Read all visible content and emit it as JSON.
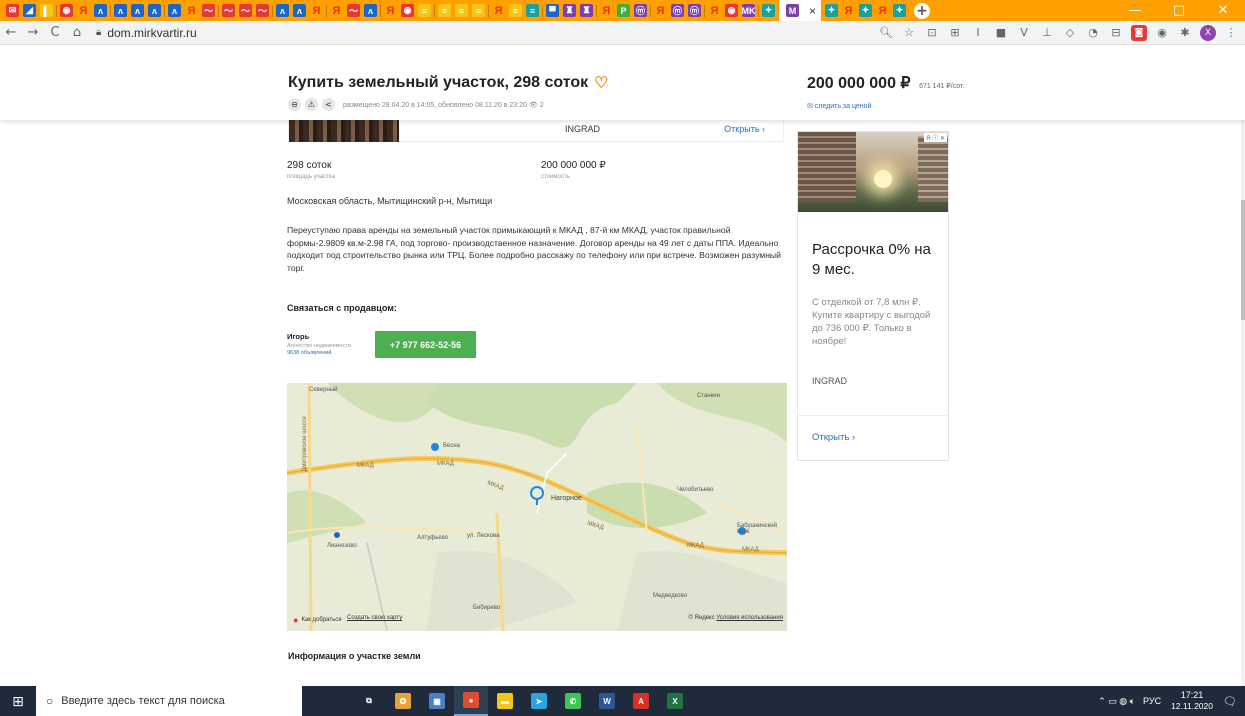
{
  "browser": {
    "tab_favicons": [
      {
        "kind": "red",
        "glyph": "✉"
      },
      {
        "kind": "blue",
        "glyph": "◢"
      },
      {
        "kind": "yellow",
        "glyph": "▌"
      },
      {
        "kind": "red",
        "glyph": "◉"
      },
      {
        "kind": "ya",
        "glyph": "Я"
      },
      {
        "kind": "blue",
        "glyph": "ʌ"
      },
      {
        "kind": "blue",
        "glyph": "ʌ"
      },
      {
        "kind": "blue",
        "glyph": "ʌ"
      },
      {
        "kind": "blue",
        "glyph": "ʌ"
      },
      {
        "kind": "blue",
        "glyph": "ʌ"
      },
      {
        "kind": "ya",
        "glyph": "Я"
      },
      {
        "kind": "red",
        "glyph": "～"
      },
      {
        "kind": "red",
        "glyph": "～"
      },
      {
        "kind": "red",
        "glyph": "～"
      },
      {
        "kind": "red",
        "glyph": "～"
      },
      {
        "kind": "blue",
        "glyph": "ʌ"
      },
      {
        "kind": "blue",
        "glyph": "ʌ"
      },
      {
        "kind": "ya",
        "glyph": "Я"
      },
      {
        "kind": "ya",
        "glyph": "Я"
      },
      {
        "kind": "red",
        "glyph": "～"
      },
      {
        "kind": "blue",
        "glyph": "ʌ"
      },
      {
        "kind": "ya",
        "glyph": "Я"
      },
      {
        "kind": "red",
        "glyph": "◉"
      },
      {
        "kind": "yellow",
        "glyph": "≡"
      },
      {
        "kind": "yellow",
        "glyph": "≡"
      },
      {
        "kind": "yellow",
        "glyph": "≡"
      },
      {
        "kind": "yellow",
        "glyph": "≡"
      },
      {
        "kind": "ya",
        "glyph": "Я"
      },
      {
        "kind": "yellow",
        "glyph": "≡"
      },
      {
        "kind": "teal",
        "glyph": "≡"
      },
      {
        "kind": "blue",
        "glyph": "▀"
      },
      {
        "kind": "purple",
        "glyph": "♜"
      },
      {
        "kind": "purple",
        "glyph": "♜"
      },
      {
        "kind": "ya",
        "glyph": "Я"
      },
      {
        "kind": "green",
        "glyph": "P"
      },
      {
        "kind": "purple",
        "glyph": "ⓜ"
      },
      {
        "kind": "ya",
        "glyph": "Я"
      },
      {
        "kind": "purple",
        "glyph": "ⓜ"
      },
      {
        "kind": "purple",
        "glyph": "ⓜ"
      },
      {
        "kind": "ya",
        "glyph": "Я"
      },
      {
        "kind": "red",
        "glyph": "◉"
      },
      {
        "kind": "purple",
        "glyph": "MK"
      },
      {
        "kind": "teal",
        "glyph": "✦"
      }
    ],
    "active_tab_close": "×",
    "tab_favicons_after": [
      {
        "kind": "teal",
        "glyph": "✦"
      },
      {
        "kind": "ya",
        "glyph": "Я"
      },
      {
        "kind": "teal",
        "glyph": "✦"
      },
      {
        "kind": "ya",
        "glyph": "Я"
      },
      {
        "kind": "teal",
        "glyph": "✦"
      }
    ],
    "new_tab": "+",
    "window_controls": {
      "minimize": "—",
      "maximize": "□",
      "close": "✕"
    },
    "nav": {
      "back": "←",
      "forward": "→",
      "reload": "C",
      "home": "⌂"
    },
    "url": "dom.mirkvartir.ru",
    "extensions": [
      {
        "glyph": "🔍︎",
        "kind": "plain"
      },
      {
        "glyph": "☆",
        "kind": "plain"
      },
      {
        "glyph": "⊡",
        "kind": "plain"
      },
      {
        "glyph": "⊞",
        "kind": "plain"
      },
      {
        "glyph": "I",
        "kind": "plain"
      },
      {
        "glyph": "■",
        "kind": "plain"
      },
      {
        "glyph": "V",
        "kind": "plain"
      },
      {
        "glyph": "⊥",
        "kind": "plain"
      },
      {
        "glyph": "◇",
        "kind": "plain"
      },
      {
        "glyph": "◔",
        "kind": "plain"
      },
      {
        "glyph": "⊟",
        "kind": "plain"
      },
      {
        "glyph": "◙",
        "kind": "sq-red"
      },
      {
        "glyph": "◉",
        "kind": "plain"
      },
      {
        "glyph": "✱",
        "kind": "plain"
      },
      {
        "glyph": "X",
        "kind": "profile"
      },
      {
        "glyph": "⋮",
        "kind": "plain"
      }
    ]
  },
  "header": {
    "title": "Купить земельный участок, 298 соток",
    "heart_icon": "♡",
    "print_icon": "⊖",
    "warn_icon": "⚠",
    "share_icon": "<",
    "posted": "размещено 28.04.20 в 14:05, обновлено 08.11.20 в 23:20",
    "views_icon": "👁︎",
    "views": "2",
    "price": "200 000 000 ₽",
    "price_per": "671 141 ₽/сот.",
    "watch_price": "✉ следить за ценой"
  },
  "agency_strip": {
    "name": "INGRAD",
    "open": "Открыть ›"
  },
  "stats": [
    {
      "value": "298 соток",
      "label": "площадь участка"
    },
    {
      "value": "200 000 000 ₽",
      "label": "стоимость"
    }
  ],
  "location": "Московская область, Мытищинский р-н, Мытищи",
  "description": "Переуступаю права аренды на земельный участок примыкающий к МКАД , 87-й км МКАД, участок правильной формы-2.9809 кв.м-2.98 ГА, под торгово- производственное назначение. Договор аренды на 49 лет с даты ППА. Идеально подходит под строительство рынка или ТРЦ. Более подробно расскажу по телефону или при встрече. Возможен разумный торг.",
  "contact": {
    "title": "Связаться с продавцом:",
    "seller_name": "Игорь",
    "seller_role": "Агентство недвижимости",
    "seller_ads": "9638 объявлений",
    "phone": "+7 977 662-52-56"
  },
  "map": {
    "labels": [
      {
        "text": "Северный"
      },
      {
        "text": "Дмитровское шоссе"
      },
      {
        "text": "Весна"
      },
      {
        "text": "МКАД"
      },
      {
        "text": "МКАД"
      },
      {
        "text": "МКАД"
      },
      {
        "text": "Нагорное"
      },
      {
        "text": "Челобитьево"
      },
      {
        "text": "МКАД"
      },
      {
        "text": "МКАД"
      },
      {
        "text": "Лианозово"
      },
      {
        "text": "Алтуфьево"
      },
      {
        "text": "ул. Лескова"
      },
      {
        "text": "Бибирево"
      },
      {
        "text": "Медведково"
      },
      {
        "text": "Бабушкинский парк"
      },
      {
        "text": "Станкин"
      },
      {
        "text": "МКАД"
      }
    ],
    "route": "Как добраться",
    "create_map": "Создать свою карту",
    "credit_brand": "© Яндекс",
    "credit_terms": "Условия использования"
  },
  "info_title": "Информация о участке земли",
  "ad": {
    "badge": "Я ⓘ ✕",
    "headline": "Рассрочка 0% на 9 мес.",
    "text": "С отделкой от 7,8 млн ₽. Купите квартиру с выгодой до 736 000 ₽. Только в ноябре!",
    "brand": "INGRAD",
    "open": "Открыть ›"
  },
  "taskbar": {
    "start_icon": "⊞",
    "search_icon": "○",
    "search_placeholder": "Введите здесь текст для поиска",
    "apps": [
      {
        "name": "task-view",
        "glyph": "⧉",
        "color": "#1f2b3a"
      },
      {
        "name": "people",
        "glyph": "✪",
        "color": "#e8a23a"
      },
      {
        "name": "calculator",
        "glyph": "▦",
        "color": "#4a7fc1"
      },
      {
        "name": "chrome",
        "glyph": "●",
        "color": "#e04c2f",
        "active": true
      },
      {
        "name": "explorer",
        "glyph": "▬",
        "color": "#f5c518"
      },
      {
        "name": "telegram",
        "glyph": "➤",
        "color": "#2aa3df"
      },
      {
        "name": "whatsapp",
        "glyph": "✆",
        "color": "#3cc35a"
      },
      {
        "name": "word",
        "glyph": "W",
        "color": "#2b579a"
      },
      {
        "name": "acrobat",
        "glyph": "A",
        "color": "#d93025"
      },
      {
        "name": "excel",
        "glyph": "X",
        "color": "#217346"
      }
    ],
    "tray_icons": "⌃ ▭ ◍ 🔈︎",
    "lang": "РУС",
    "time": "17:21",
    "date": "12.11.2020",
    "notifications": "🗨︎"
  }
}
